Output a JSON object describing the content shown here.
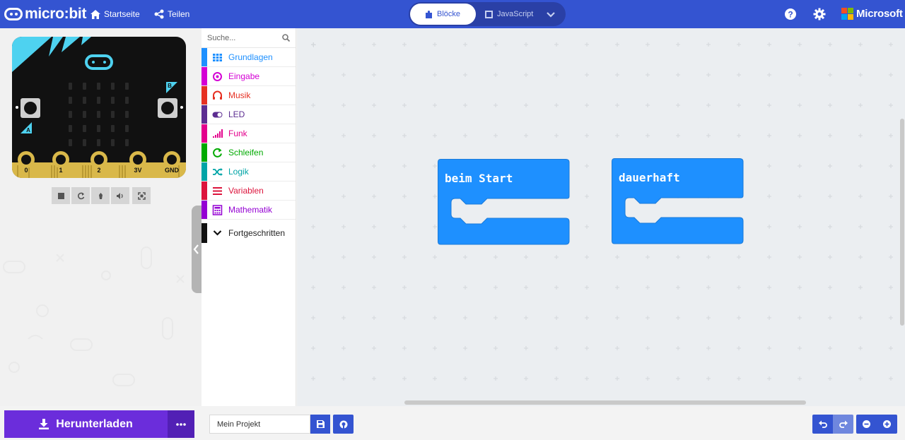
{
  "app": {
    "logo_text": "micro:bit"
  },
  "nav": {
    "home_label": "Startseite",
    "share_label": "Teilen"
  },
  "mode": {
    "blocks_label": "Blöcke",
    "javascript_label": "JavaScript"
  },
  "brand": {
    "microsoft_label": "Microsoft"
  },
  "simulator": {
    "pins": [
      "0",
      "1",
      "2",
      "3V",
      "GND"
    ],
    "buttons": [
      "A",
      "B"
    ]
  },
  "toolbox": {
    "search_placeholder": "Suche...",
    "categories": [
      {
        "label": "Grundlagen",
        "color": "#1e90ff",
        "icon": "grid-icon"
      },
      {
        "label": "Eingabe",
        "color": "#d400d4",
        "icon": "target-icon"
      },
      {
        "label": "Musik",
        "color": "#e63022",
        "icon": "headphones-icon"
      },
      {
        "label": "LED",
        "color": "#5c2d91",
        "icon": "toggle-icon"
      },
      {
        "label": "Funk",
        "color": "#e3008c",
        "icon": "signal-bars-icon"
      },
      {
        "label": "Schleifen",
        "color": "#00aa00",
        "icon": "refresh-icon"
      },
      {
        "label": "Logik",
        "color": "#00a4a6",
        "icon": "shuffle-icon"
      },
      {
        "label": "Variablen",
        "color": "#dc143c",
        "icon": "list-icon"
      },
      {
        "label": "Mathematik",
        "color": "#9400d3",
        "icon": "calculator-icon"
      },
      {
        "label": "Fortgeschritten",
        "color": "#111111",
        "icon": "chevron-down-icon"
      }
    ]
  },
  "workspace": {
    "blocks": [
      {
        "label": "beim Start",
        "color": "#1e90ff"
      },
      {
        "label": "dauerhaft",
        "color": "#1e90ff"
      }
    ]
  },
  "bottombar": {
    "download_label": "Herunterladen",
    "project_name": "Mein Projekt"
  }
}
